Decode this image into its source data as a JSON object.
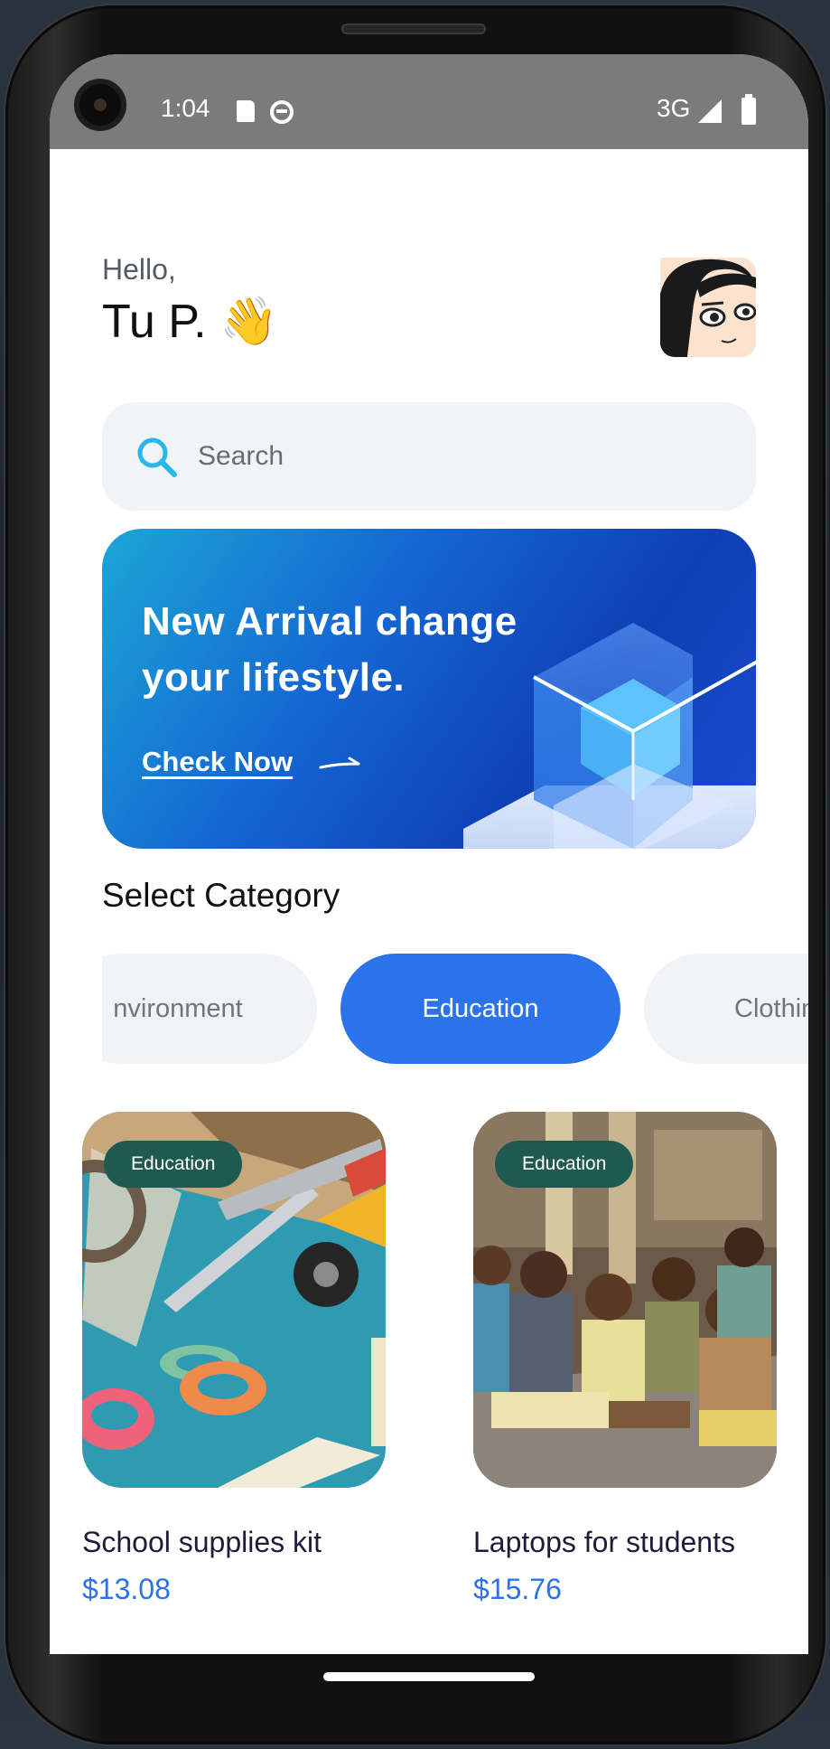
{
  "status_bar": {
    "time": "1:04",
    "network": "3G",
    "icons": [
      "sd-card-icon",
      "robot-icon",
      "signal-icon",
      "battery-icon"
    ]
  },
  "header": {
    "greeting": "Hello,",
    "user_name": "Tu P. 👋",
    "avatar": "avatar-cartoon-girl"
  },
  "search": {
    "placeholder": "Search",
    "icon": "search-icon",
    "icon_color": "#29b6e8"
  },
  "banner": {
    "title": "New Arrival change your lifestyle.",
    "link_label": "Check Now",
    "colors": [
      "#1ca6d6",
      "#1466d2",
      "#0f3fb5"
    ]
  },
  "categories": {
    "title": "Select Category",
    "items": [
      "Environment",
      "Education",
      "Clothing"
    ],
    "visible_items": [
      "nvironment",
      "Education",
      "Clothin"
    ],
    "selected": "Education",
    "selected_color": "#2a73ea"
  },
  "products": [
    {
      "badge": "Education",
      "title": "School supplies kit",
      "price": "$13.08"
    },
    {
      "badge": "Education",
      "title": "Laptops for students",
      "price": "$15.76"
    }
  ],
  "colors": {
    "badge": "#1e5a50",
    "price": "#2a73ea",
    "surface": "#f2f3f7"
  }
}
